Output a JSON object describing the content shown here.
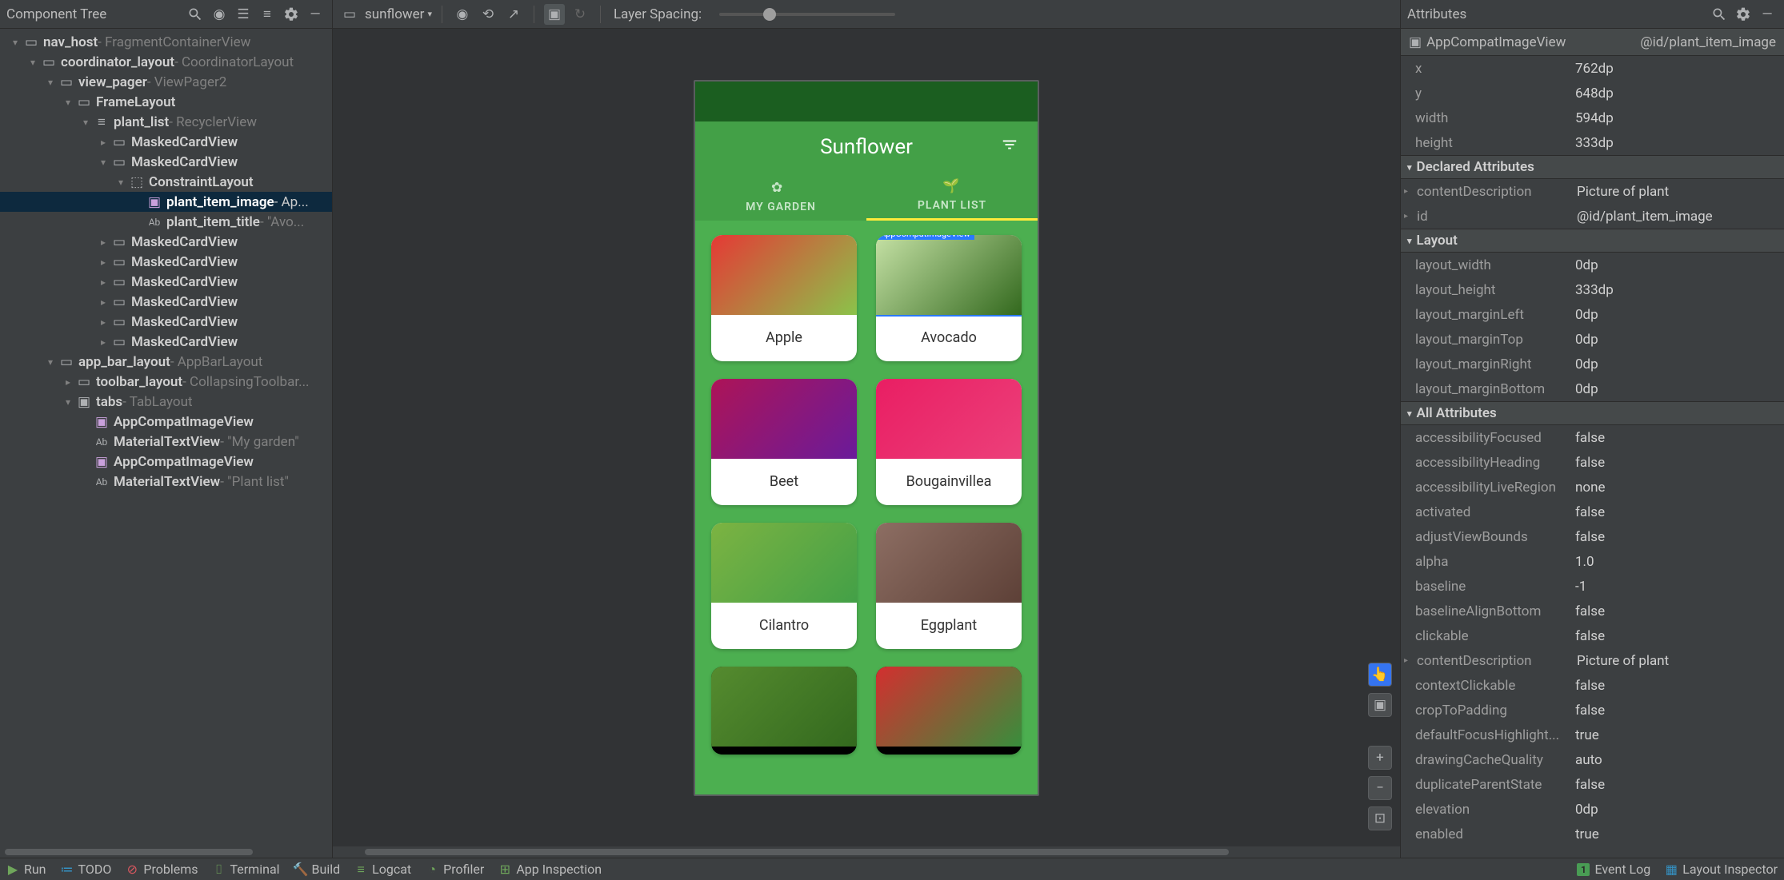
{
  "left": {
    "title": "Component Tree",
    "tree": [
      {
        "d": 0,
        "exp": "▾",
        "icon": "view",
        "name": "nav_host",
        "type": " - FragmentContainerView",
        "sel": false
      },
      {
        "d": 1,
        "exp": "▾",
        "icon": "view",
        "name": "coordinator_layout",
        "type": " - CoordinatorLayout",
        "sel": false
      },
      {
        "d": 2,
        "exp": "▾",
        "icon": "pager",
        "name": "view_pager",
        "type": " - ViewPager2",
        "sel": false
      },
      {
        "d": 3,
        "exp": "▾",
        "icon": "frame",
        "name": "FrameLayout",
        "type": "",
        "sel": false
      },
      {
        "d": 4,
        "exp": "▾",
        "icon": "list",
        "name": "plant_list",
        "type": " - RecyclerView",
        "sel": false
      },
      {
        "d": 5,
        "exp": "▸",
        "icon": "card",
        "name": "MaskedCardView",
        "type": "",
        "sel": false
      },
      {
        "d": 5,
        "exp": "▾",
        "icon": "card",
        "name": "MaskedCardView",
        "type": "",
        "sel": false
      },
      {
        "d": 6,
        "exp": "▾",
        "icon": "constraint",
        "name": "ConstraintLayout",
        "type": "",
        "sel": false
      },
      {
        "d": 7,
        "exp": "",
        "icon": "image",
        "name": "plant_item_image",
        "type": " - Ap...",
        "sel": true
      },
      {
        "d": 7,
        "exp": "",
        "icon": "text",
        "name": "plant_item_title",
        "type": " - \"Avo...",
        "sel": false
      },
      {
        "d": 5,
        "exp": "▸",
        "icon": "card",
        "name": "MaskedCardView",
        "type": "",
        "sel": false
      },
      {
        "d": 5,
        "exp": "▸",
        "icon": "card",
        "name": "MaskedCardView",
        "type": "",
        "sel": false
      },
      {
        "d": 5,
        "exp": "▸",
        "icon": "card",
        "name": "MaskedCardView",
        "type": "",
        "sel": false
      },
      {
        "d": 5,
        "exp": "▸",
        "icon": "card",
        "name": "MaskedCardView",
        "type": "",
        "sel": false
      },
      {
        "d": 5,
        "exp": "▸",
        "icon": "card",
        "name": "MaskedCardView",
        "type": "",
        "sel": false
      },
      {
        "d": 5,
        "exp": "▸",
        "icon": "card",
        "name": "MaskedCardView",
        "type": "",
        "sel": false
      },
      {
        "d": 2,
        "exp": "▾",
        "icon": "view",
        "name": "app_bar_layout",
        "type": " - AppBarLayout",
        "sel": false
      },
      {
        "d": 3,
        "exp": "▸",
        "icon": "view",
        "name": "toolbar_layout",
        "type": " - CollapsingToolbar...",
        "sel": false
      },
      {
        "d": 3,
        "exp": "▾",
        "icon": "folder",
        "name": "tabs",
        "type": " - TabLayout",
        "sel": false
      },
      {
        "d": 4,
        "exp": "",
        "icon": "image",
        "name": "AppCompatImageView",
        "type": "",
        "sel": false
      },
      {
        "d": 4,
        "exp": "",
        "icon": "text",
        "name": "MaterialTextView",
        "type": " - \"My garden\"",
        "sel": false
      },
      {
        "d": 4,
        "exp": "",
        "icon": "image",
        "name": "AppCompatImageView",
        "type": "",
        "sel": false
      },
      {
        "d": 4,
        "exp": "",
        "icon": "text",
        "name": "MaterialTextView",
        "type": " - \"Plant list\"",
        "sel": false
      }
    ]
  },
  "center": {
    "device_selector": "sunflower",
    "layer_spacing_label": "Layer Spacing:",
    "app_title": "Sunflower",
    "tab1": "MY GARDEN",
    "tab2": "PLANT LIST",
    "sel_badge": "AppCompatImageView",
    "cards": [
      {
        "title": "Apple",
        "g": "linear-gradient(135deg,#e53935,#8bc34a)"
      },
      {
        "title": "Avocado",
        "g": "linear-gradient(135deg,#c5e1a5,#33691e)",
        "sel": true
      },
      {
        "title": "Beet",
        "g": "linear-gradient(135deg,#ad1457,#6a1b9a)"
      },
      {
        "title": "Bougainvillea",
        "g": "linear-gradient(135deg,#e91e63,#ec407a)"
      },
      {
        "title": "Cilantro",
        "g": "linear-gradient(135deg,#7cb342,#43a047)"
      },
      {
        "title": "Eggplant",
        "g": "linear-gradient(135deg,#8d6e63,#5d4037)"
      },
      {
        "title": "",
        "g": "linear-gradient(135deg,#558b2f,#33691e)",
        "partial": true
      },
      {
        "title": "",
        "g": "linear-gradient(135deg,#d32f2f,#388e3c)",
        "partial": true
      }
    ]
  },
  "right": {
    "title": "Attributes",
    "breadcrumb_type": "AppCompatImageView",
    "breadcrumb_id": "@id/plant_item_image",
    "pos": [
      {
        "k": "x",
        "v": "762dp"
      },
      {
        "k": "y",
        "v": "648dp"
      },
      {
        "k": "width",
        "v": "594dp"
      },
      {
        "k": "height",
        "v": "333dp"
      }
    ],
    "sec_declared": "Declared Attributes",
    "declared": [
      {
        "k": "contentDescription",
        "v": "Picture of plant",
        "exp": true
      },
      {
        "k": "id",
        "v": "@id/plant_item_image",
        "exp": true
      }
    ],
    "sec_layout": "Layout",
    "layout": [
      {
        "k": "layout_width",
        "v": "0dp"
      },
      {
        "k": "layout_height",
        "v": "333dp"
      },
      {
        "k": "layout_marginLeft",
        "v": "0dp"
      },
      {
        "k": "layout_marginTop",
        "v": "0dp"
      },
      {
        "k": "layout_marginRight",
        "v": "0dp"
      },
      {
        "k": "layout_marginBottom",
        "v": "0dp"
      }
    ],
    "sec_all": "All Attributes",
    "all": [
      {
        "k": "accessibilityFocused",
        "v": "false"
      },
      {
        "k": "accessibilityHeading",
        "v": "false"
      },
      {
        "k": "accessibilityLiveRegion",
        "v": "none"
      },
      {
        "k": "activated",
        "v": "false"
      },
      {
        "k": "adjustViewBounds",
        "v": "false"
      },
      {
        "k": "alpha",
        "v": "1.0"
      },
      {
        "k": "baseline",
        "v": "-1"
      },
      {
        "k": "baselineAlignBottom",
        "v": "false"
      },
      {
        "k": "clickable",
        "v": "false"
      },
      {
        "k": "contentDescription",
        "v": "Picture of plant",
        "exp": true
      },
      {
        "k": "contextClickable",
        "v": "false"
      },
      {
        "k": "cropToPadding",
        "v": "false"
      },
      {
        "k": "defaultFocusHighlight...",
        "v": "true"
      },
      {
        "k": "drawingCacheQuality",
        "v": "auto"
      },
      {
        "k": "duplicateParentState",
        "v": "false"
      },
      {
        "k": "elevation",
        "v": "0dp"
      },
      {
        "k": "enabled",
        "v": "true"
      }
    ]
  },
  "bottom": {
    "items": [
      "Run",
      "TODO",
      "Problems",
      "Terminal",
      "Build",
      "Logcat",
      "Profiler",
      "App Inspection"
    ],
    "event_log": "Event Log",
    "layout_inspector": "Layout Inspector",
    "event_count": "1"
  }
}
